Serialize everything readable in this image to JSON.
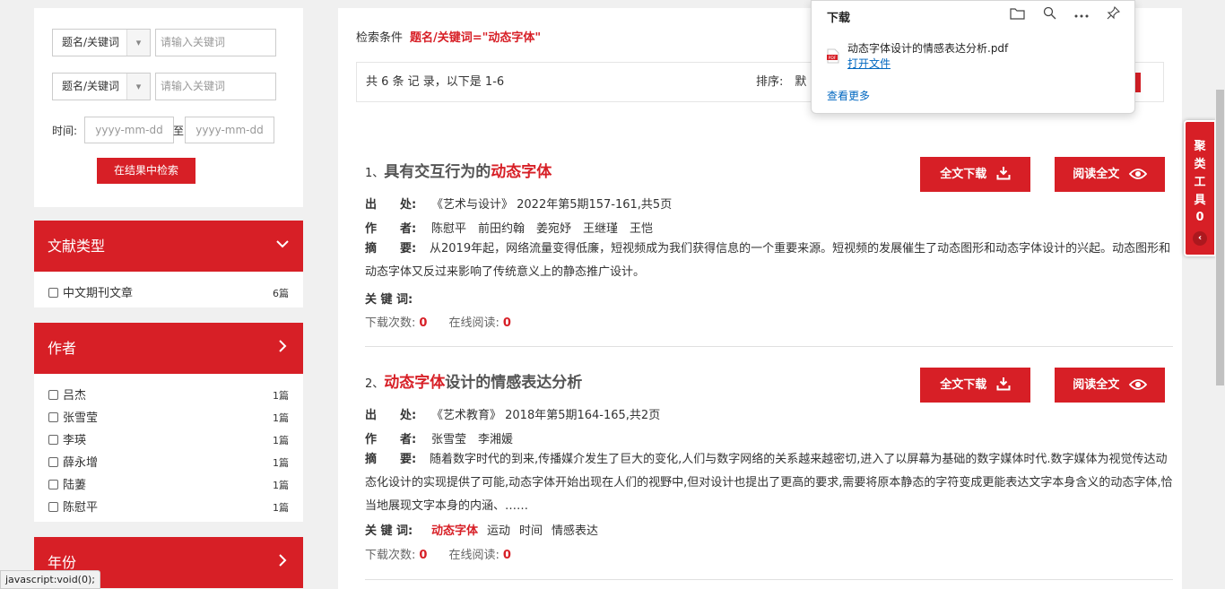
{
  "search": {
    "field1": "题名/关键词",
    "field1_placeholder": "请输入关键词",
    "field2": "题名/关键词",
    "field2_placeholder": "请输入关键词",
    "time_label": "时间:",
    "date_from": "yyyy-mm-dd",
    "to": "至",
    "date_to": "yyyy-mm-dd",
    "button": "在结果中检索"
  },
  "facets": {
    "doctype": {
      "title": "文献类型",
      "items": [
        {
          "label": "中文期刊文章",
          "count": "6篇"
        }
      ]
    },
    "author": {
      "title": "作者",
      "items": [
        {
          "label": "吕杰",
          "count": "1篇"
        },
        {
          "label": "张雪莹",
          "count": "1篇"
        },
        {
          "label": "李瑛",
          "count": "1篇"
        },
        {
          "label": "薛永增",
          "count": "1篇"
        },
        {
          "label": "陆萋",
          "count": "1篇"
        },
        {
          "label": "陈慰平",
          "count": "1篇"
        }
      ]
    },
    "year": {
      "title": "年份"
    }
  },
  "status_bar": "javascript:void(0);",
  "main": {
    "criteria_label": "检索条件",
    "criteria_value": "题名/关键词=\"动态字体\"",
    "summary": "共 6 条 记 录，以下是 1-6",
    "sort_label": "排序:",
    "sort_value": "默"
  },
  "buttons": {
    "download": "全文下载",
    "read": "阅读全文"
  },
  "labels": {
    "source": "出　　处:",
    "authors": "作　　者:",
    "abstract": "摘　　要:",
    "keywords": "关 键 词:",
    "downloads": "下载次数:",
    "online": "在线阅读:"
  },
  "results": [
    {
      "num": "1、",
      "title_pre": "具有交互行为的",
      "title_hl": "动态字体",
      "title_post": "",
      "source": "《艺术与设计》 2022年第5期157-161,共5页",
      "authors": "陈慰平　前田约翰　姜宛妤　王继瑾　王恺",
      "abstract": "从2019年起，网络流量变得低廉，短视频成为我们获得信息的一个重要来源。短视频的发展催生了动态图形和动态字体设计的兴起。动态图形和动态字体又反过来影响了传统意义上的静态推广设计。",
      "keywords_hl": "",
      "keywords": [],
      "downloads": "0",
      "online": "0"
    },
    {
      "num": "2、",
      "title_pre": "",
      "title_hl": "动态字体",
      "title_post": "设计的情感表达分析",
      "source": "《艺术教育》 2018年第5期164-165,共2页",
      "authors": "张雪莹　李湘媛",
      "abstract": "随着数字时代的到来,传播媒介发生了巨大的变化,人们与数字网络的关系越来越密切,进入了以屏幕为基础的数字媒体时代.数字媒体为视觉传达动态化设计的实现提供了可能,动态字体开始出现在人们的视野中,但对设计也提出了更高的要求,需要将原本静态的字符变成更能表达文字本身含义的动态字体,恰当地展现文字本身的内涵、……",
      "keywords_hl": "动态字体",
      "keywords": [
        "运动",
        "时间",
        "情感表达"
      ],
      "downloads": "0",
      "online": "0"
    }
  ],
  "download_panel": {
    "title": "下载",
    "filename": "动态字体设计的情感表达分析.pdf",
    "open": "打开文件",
    "more": "查看更多",
    "pdf_tag": "PDF"
  },
  "tool": {
    "label": "聚类工具",
    "count": "0",
    "arrow": "‹"
  },
  "colors": {
    "accent": "#d71f26",
    "link": "#0067c0"
  }
}
